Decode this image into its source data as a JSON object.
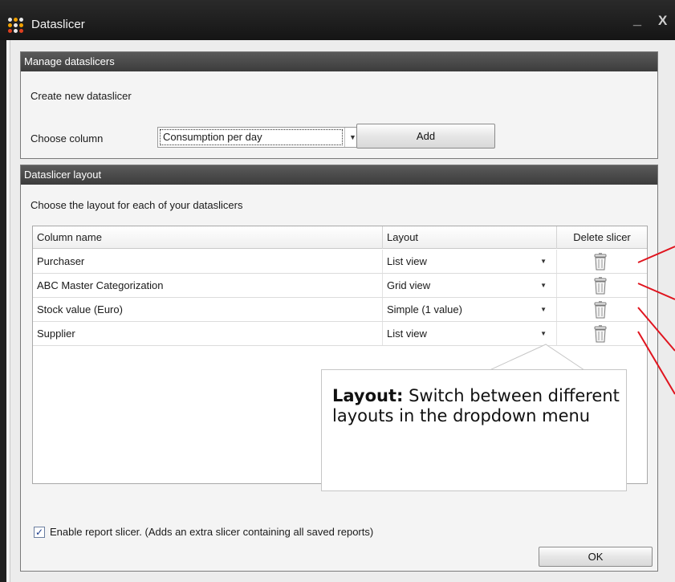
{
  "window": {
    "title": "Dataslicer",
    "minimize": "_",
    "close": "X"
  },
  "manage": {
    "header": "Manage dataslicers",
    "create_label": "Create new dataslicer",
    "column_label": "Choose column",
    "column_value": "Consumption per day",
    "add_label": "Add"
  },
  "layout_panel": {
    "header": "Dataslicer layout",
    "instruction": "Choose the layout for each of your dataslicers",
    "columns": {
      "name": "Column name",
      "layout": "Layout",
      "delete": "Delete slicer"
    },
    "rows": [
      {
        "name": "Purchaser",
        "layout": "List view"
      },
      {
        "name": "ABC Master Categorization",
        "layout": "Grid view"
      },
      {
        "name": "Stock value (Euro)",
        "layout": "Simple (1 value)"
      },
      {
        "name": "Supplier",
        "layout": "List view"
      }
    ]
  },
  "callout": {
    "bold": "Layout:",
    "text": " Switch between different layouts in the dropdown menu"
  },
  "report_slicer": {
    "checked": true,
    "label": "Enable report slicer. (Adds an extra slicer containing all saved reports)"
  },
  "ok_label": "OK",
  "colors": {
    "annotation_line": "#e0141e",
    "title_bar": "#1c1c1c",
    "panel_header": "#4a4a4a"
  },
  "icons": [
    "app-grid-icon",
    "trash-icon",
    "dropdown-arrow-icon",
    "checkbox-check-icon"
  ]
}
